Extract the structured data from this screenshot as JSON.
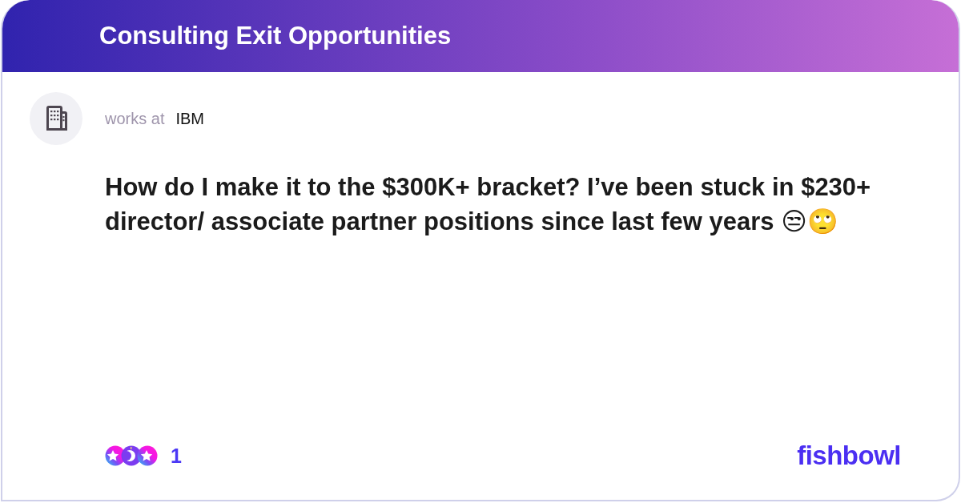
{
  "header": {
    "title": "Consulting Exit Opportunities"
  },
  "post": {
    "author": {
      "label": "works at",
      "company": "IBM"
    },
    "text": "How do I make it to the $300K+ bracket? I’ve been stuck in $230+ director/ associate partner positions since last few years 😒🙄"
  },
  "footer": {
    "reaction_count": "1",
    "logo": "fishbowl"
  }
}
